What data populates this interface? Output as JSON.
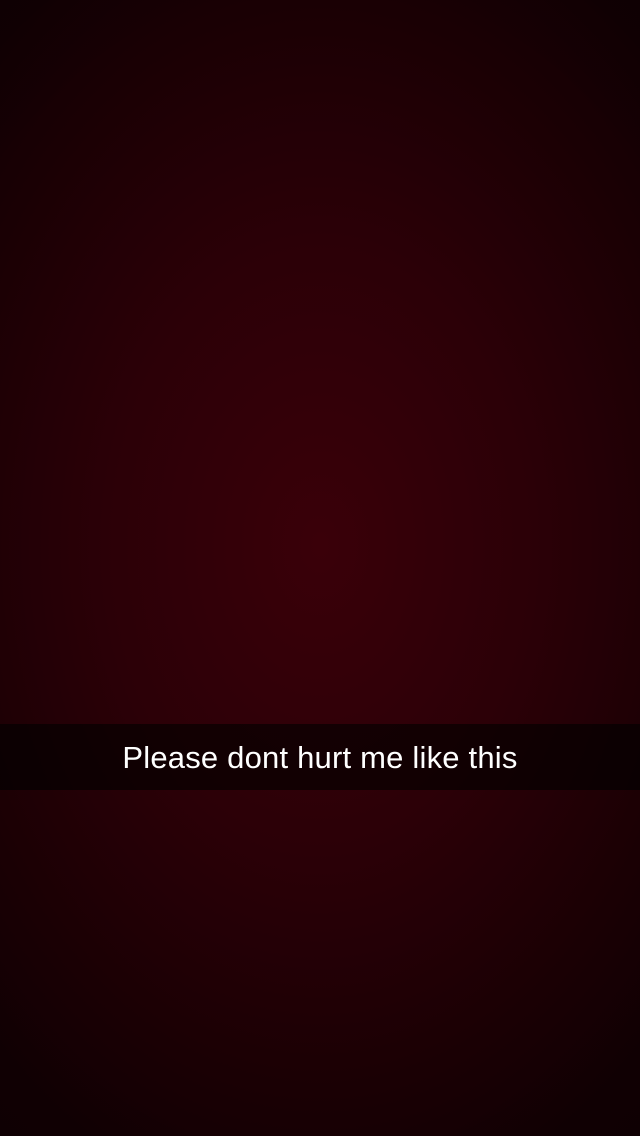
{
  "snap": {
    "caption": "Please dont hurt me like this"
  },
  "colors": {
    "background_center": "#3a0009",
    "background_edge": "#110003",
    "caption_bar": "rgba(0,0,0,0.6)",
    "caption_text": "#ffffff"
  }
}
